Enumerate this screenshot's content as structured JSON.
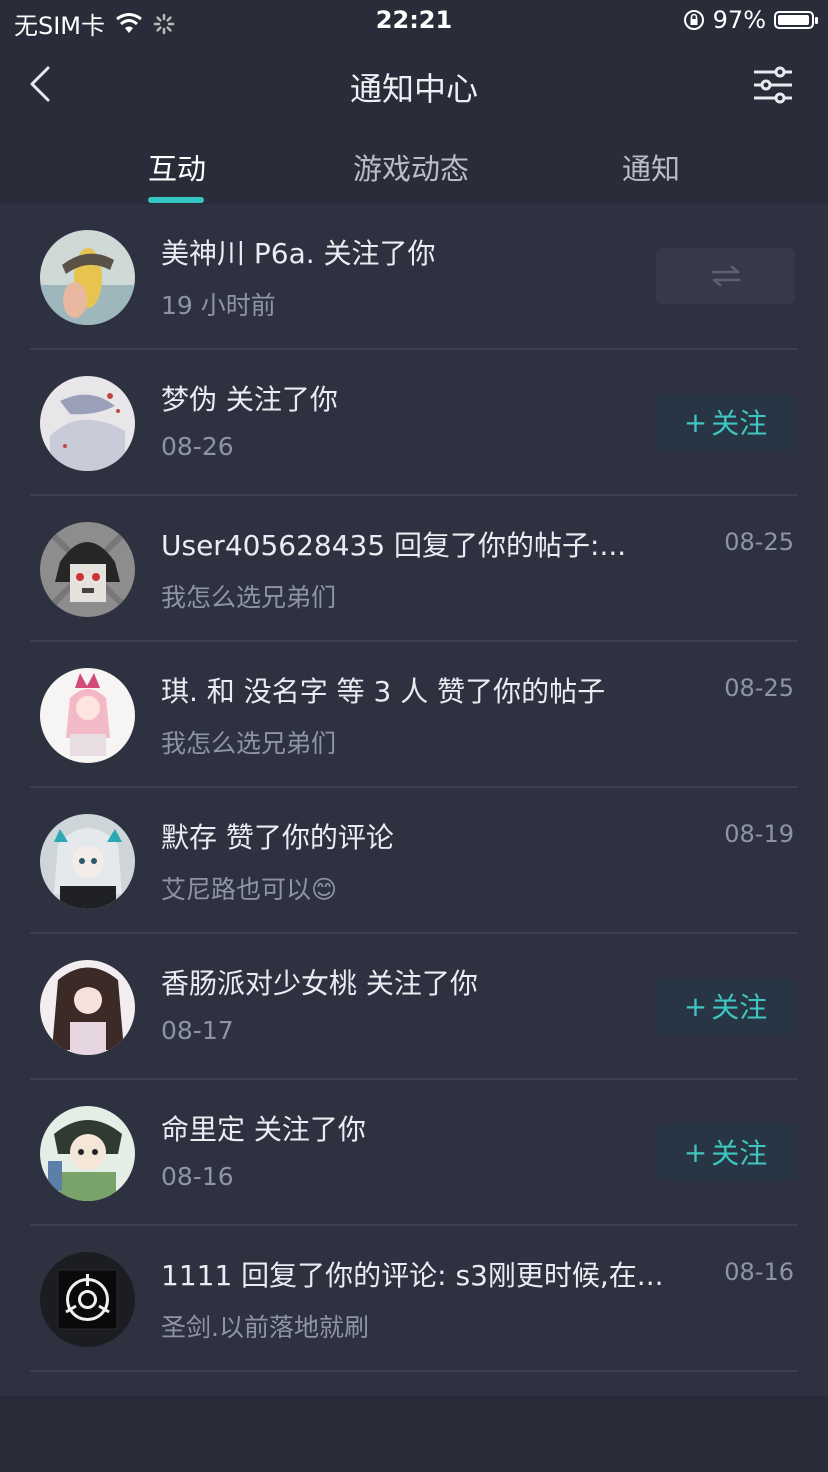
{
  "status_bar": {
    "carrier": "无SIM卡",
    "time": "22:21",
    "battery": "97%"
  },
  "navbar": {
    "title": "通知中心"
  },
  "tabs": [
    {
      "label": "互动",
      "active": true
    },
    {
      "label": "游戏动态",
      "active": false
    },
    {
      "label": "通知",
      "active": false
    }
  ],
  "notifications": [
    {
      "title": "美神川 P6a. 关注了你",
      "sub": "19 小时前",
      "time": "",
      "action": "mutual"
    },
    {
      "title": "梦伪 关注了你",
      "sub": "08-26",
      "time": "",
      "action": "follow"
    },
    {
      "title": "User405628435 回复了你的帖子:...",
      "sub": "我怎么选兄弟们",
      "time": "08-25",
      "action": ""
    },
    {
      "title": "琪. 和 没名字 等 3 人 赞了你的帖子",
      "sub": "我怎么选兄弟们",
      "time": "08-25",
      "action": ""
    },
    {
      "title": "默存 赞了你的评论",
      "sub": "艾尼路也可以😊",
      "time": "08-19",
      "action": ""
    },
    {
      "title": "香肠派对少女桃 关注了你",
      "sub": "08-17",
      "time": "",
      "action": "follow"
    },
    {
      "title": "命里定 关注了你",
      "sub": "08-16",
      "time": "",
      "action": "follow"
    },
    {
      "title": "1111 回复了你的评论: s3刚更时候,在...",
      "sub": "圣剑.以前落地就刷",
      "time": "08-16",
      "action": ""
    }
  ],
  "follow_label": "关注",
  "colors": {
    "accent": "#34c8c4",
    "background": "#2e3140",
    "header": "#292c39"
  },
  "icons": {
    "back": "chevron-left-icon",
    "filter": "sliders-icon",
    "mutual": "swap-arrows-icon",
    "plus": "plus-icon"
  }
}
